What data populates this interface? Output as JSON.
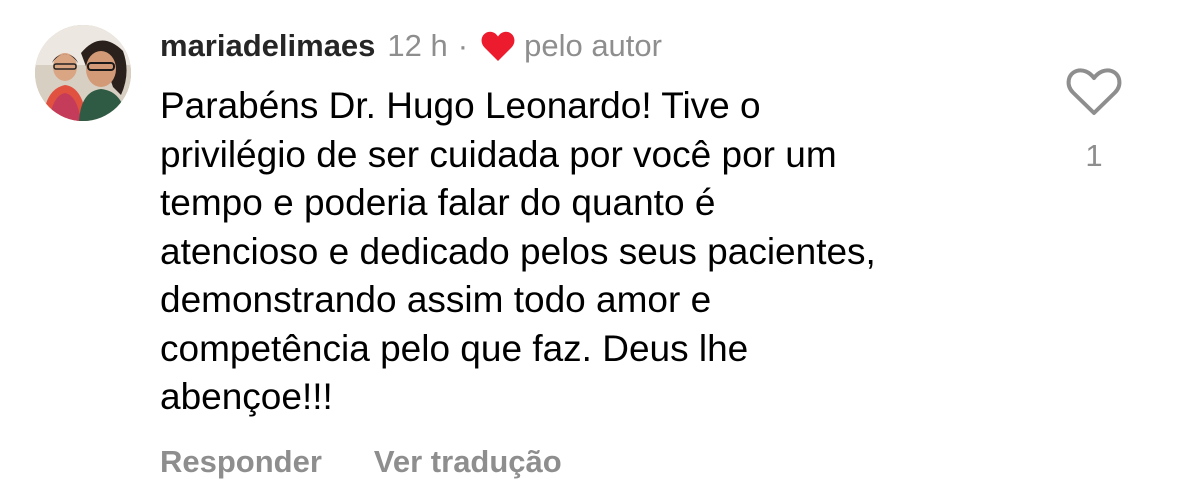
{
  "comment": {
    "username": "mariadelimaes",
    "time": "12 h",
    "separator": "·",
    "author_badge_label": "pelo autor",
    "author_heart_color": "#ed1b2e",
    "text": "Parabéns Dr. Hugo Leonardo! Tive o\nprivilégio de ser cuidada por você por um\ntempo e poderia falar do quanto é\natencioso e dedicado pelos seus pacientes,\ndemonstrando assim todo amor e\ncompetência pelo que faz. Deus lhe\nabençoe!!!",
    "like_count": "1",
    "actions": {
      "reply_label": "Responder",
      "translate_label": "Ver tradução"
    },
    "icons": {
      "avatar": "avatar",
      "author_heart": "heart-filled-icon",
      "like": "heart-outline-icon"
    }
  }
}
